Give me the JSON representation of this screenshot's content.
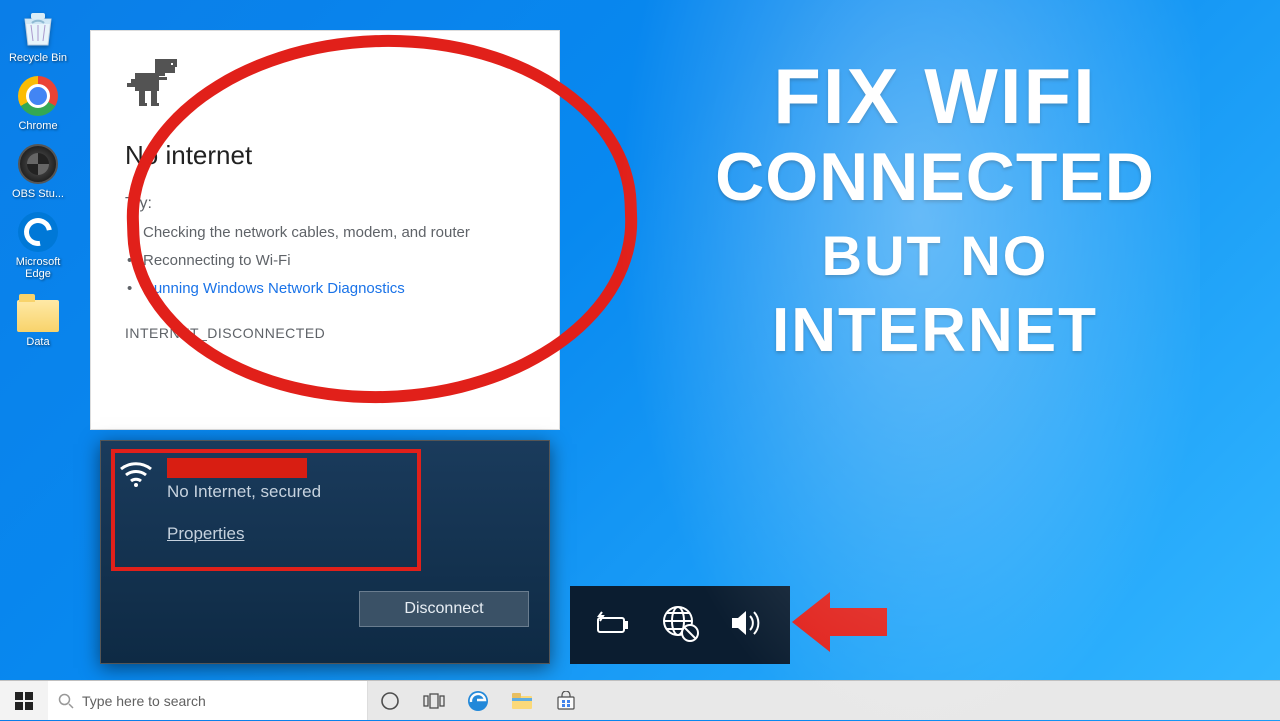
{
  "desktop": {
    "recycle": "Recycle Bin",
    "chrome": "Chrome",
    "obs": "OBS Stu...",
    "edge": "Microsoft Edge",
    "data": "Data"
  },
  "chrome_error": {
    "heading": "No internet",
    "try_label": "Try:",
    "tips": {
      "t1": "Checking the network cables, modem, and router",
      "t2": "Reconnecting to Wi-Fi",
      "t3": "Running Windows Network Diagnostics"
    },
    "err_code": "INTERNET_DISCONNECTED"
  },
  "wifi_popup": {
    "status": "No Internet, secured",
    "properties": "Properties",
    "disconnect": "Disconnect"
  },
  "headline": {
    "l1": "FIX WIFI",
    "l2": "CONNECTED",
    "l3": "BUT NO",
    "l4": "INTERNET"
  },
  "taskbar": {
    "search_placeholder": "Type here to search"
  }
}
